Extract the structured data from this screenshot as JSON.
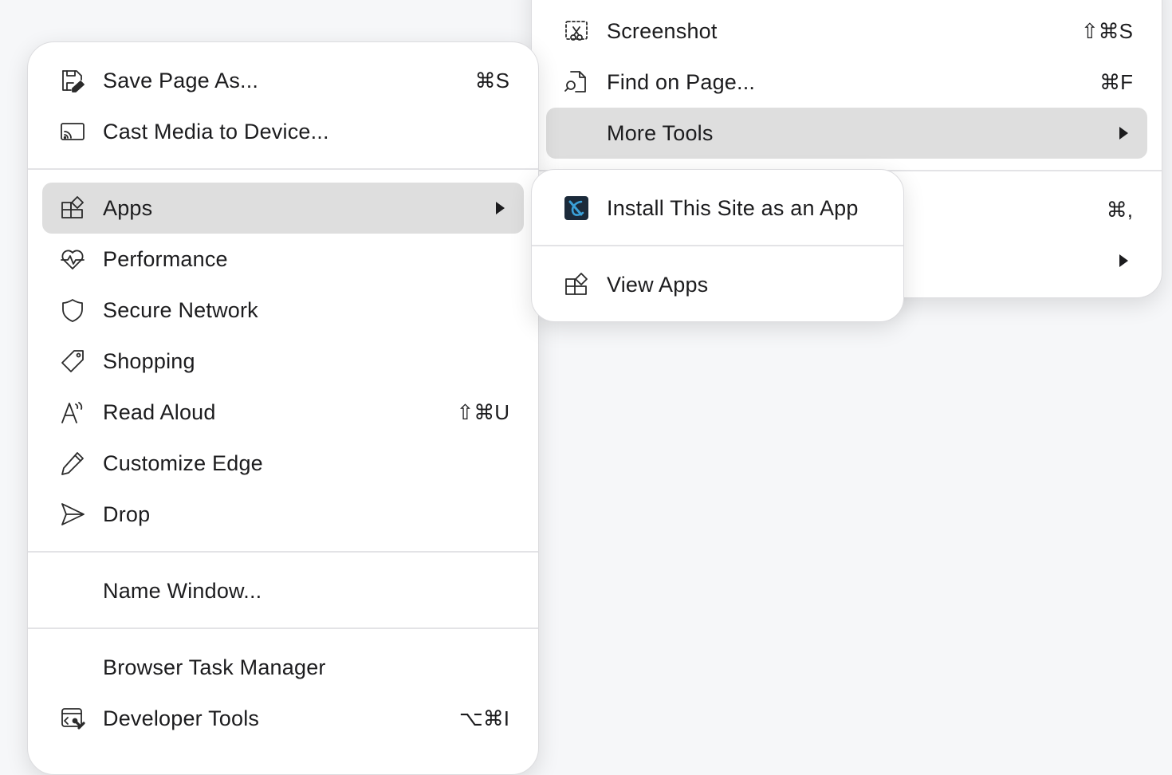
{
  "main_menu": {
    "items": [
      {
        "label": "Save Page As...",
        "shortcut": "⌘S",
        "icon": "save-icon"
      },
      {
        "label": "Cast Media to Device...",
        "shortcut": "",
        "icon": "cast-icon"
      },
      {
        "label": "Apps",
        "shortcut": "",
        "icon": "apps-icon",
        "submenu": true,
        "highlighted": true
      },
      {
        "label": "Performance",
        "shortcut": "",
        "icon": "heartbeat-icon"
      },
      {
        "label": "Secure Network",
        "shortcut": "",
        "icon": "shield-icon"
      },
      {
        "label": "Shopping",
        "shortcut": "",
        "icon": "tag-icon"
      },
      {
        "label": "Read Aloud",
        "shortcut": "⇧⌘U",
        "icon": "read-aloud-icon"
      },
      {
        "label": "Customize Edge",
        "shortcut": "",
        "icon": "pencil-icon"
      },
      {
        "label": "Drop",
        "shortcut": "",
        "icon": "send-icon"
      },
      {
        "label": "Name Window...",
        "shortcut": ""
      },
      {
        "label": "Browser Task Manager",
        "shortcut": ""
      },
      {
        "label": "Developer Tools",
        "shortcut": "⌥⌘I",
        "icon": "developer-tools-icon"
      }
    ]
  },
  "tools_menu": {
    "items": [
      {
        "label": "Screenshot",
        "shortcut": "⇧⌘S",
        "icon": "screenshot-icon"
      },
      {
        "label": "Find on Page...",
        "shortcut": "⌘F",
        "icon": "find-icon"
      },
      {
        "label": "More Tools",
        "shortcut": "",
        "submenu": true,
        "highlighted": true
      }
    ],
    "hidden_row_shortcut": "⌘,"
  },
  "apps_submenu": {
    "items": [
      {
        "label": "Install This Site as an App",
        "icon": "site-app-icon"
      },
      {
        "label": "View Apps",
        "icon": "apps-icon"
      }
    ]
  },
  "colors": {
    "highlight": "#dedede",
    "menu_background": "#ffffff",
    "page_background": "#f6f7f9",
    "site_icon_bg": "#1b2a3a",
    "site_icon_accent": "#3aa0d8"
  }
}
